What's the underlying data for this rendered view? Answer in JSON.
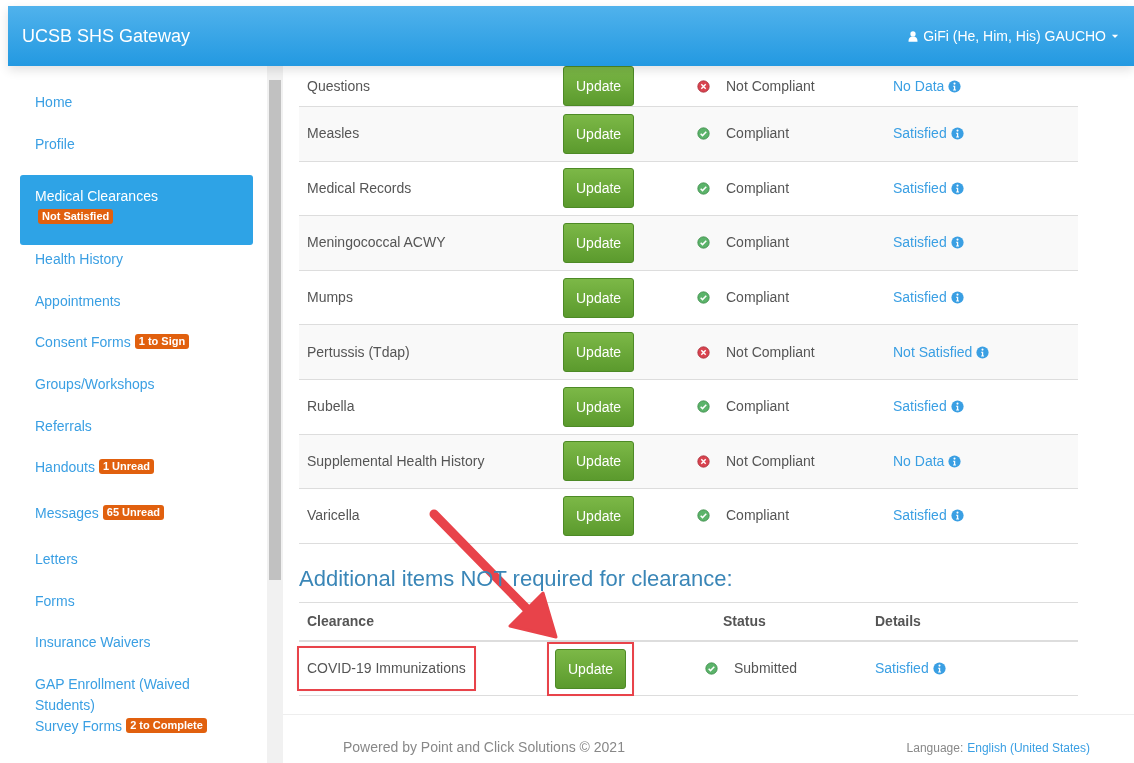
{
  "header": {
    "brand": "UCSB SHS Gateway",
    "user": "GiFi (He, Him, His) GAUCHO"
  },
  "sidebar": {
    "items": [
      {
        "label": "Home",
        "selected": false
      },
      {
        "label": "Profile",
        "selected": false
      },
      {
        "label": "Medical Clearances",
        "badge": "Not Satisfied",
        "selected": true
      },
      {
        "label": "Health History",
        "selected": false
      },
      {
        "label": "Appointments",
        "selected": false
      },
      {
        "label": "Consent Forms",
        "badge": "1 to Sign",
        "selected": false
      },
      {
        "label": "Groups/Workshops",
        "selected": false
      },
      {
        "label": "Referrals",
        "selected": false
      },
      {
        "label": "Handouts",
        "badge": "1 Unread",
        "selected": false
      },
      {
        "label": "Messages",
        "badge": "65 Unread",
        "selected": false
      },
      {
        "label": "Letters",
        "selected": false
      },
      {
        "label": "Forms",
        "selected": false
      },
      {
        "label": "Insurance Waivers",
        "selected": false
      },
      {
        "label": "GAP Enrollment (Waived Students)",
        "selected": false
      },
      {
        "label": "Survey Forms",
        "badge": "2 to Complete",
        "selected": false
      }
    ]
  },
  "clearances": {
    "rows": [
      {
        "name": "Questions",
        "button": "Update",
        "kind": "fail",
        "status": "Not Compliant",
        "details": "No Data"
      },
      {
        "name": "Measles",
        "button": "Update",
        "kind": "ok",
        "status": "Compliant",
        "details": "Satisfied"
      },
      {
        "name": "Medical Records",
        "button": "Update",
        "kind": "ok",
        "status": "Compliant",
        "details": "Satisfied"
      },
      {
        "name": "Meningococcal ACWY",
        "button": "Update",
        "kind": "ok",
        "status": "Compliant",
        "details": "Satisfied"
      },
      {
        "name": "Mumps",
        "button": "Update",
        "kind": "ok",
        "status": "Compliant",
        "details": "Satisfied"
      },
      {
        "name": "Pertussis (Tdap)",
        "button": "Update",
        "kind": "fail",
        "status": "Not Compliant",
        "details": "Not Satisfied"
      },
      {
        "name": "Rubella",
        "button": "Update",
        "kind": "ok",
        "status": "Compliant",
        "details": "Satisfied"
      },
      {
        "name": "Supplemental Health History",
        "button": "Update",
        "kind": "fail",
        "status": "Not Compliant",
        "details": "No Data"
      },
      {
        "name": "Varicella",
        "button": "Update",
        "kind": "ok",
        "status": "Compliant",
        "details": "Satisfied"
      }
    ]
  },
  "additional": {
    "heading": "Additional items NOT required for clearance:",
    "columns": [
      "Clearance",
      "Status",
      "Details"
    ],
    "rows": [
      {
        "name": "COVID-19 Immunizations",
        "button": "Update",
        "kind": "ok",
        "status": "Submitted",
        "details": "Satisfied",
        "highlighted": true
      }
    ]
  },
  "annotation": {
    "arrow": true
  },
  "footer": {
    "powered": "Powered by Point and Click Solutions © 2021",
    "language_label": "Language:",
    "language": "English (United States)"
  }
}
